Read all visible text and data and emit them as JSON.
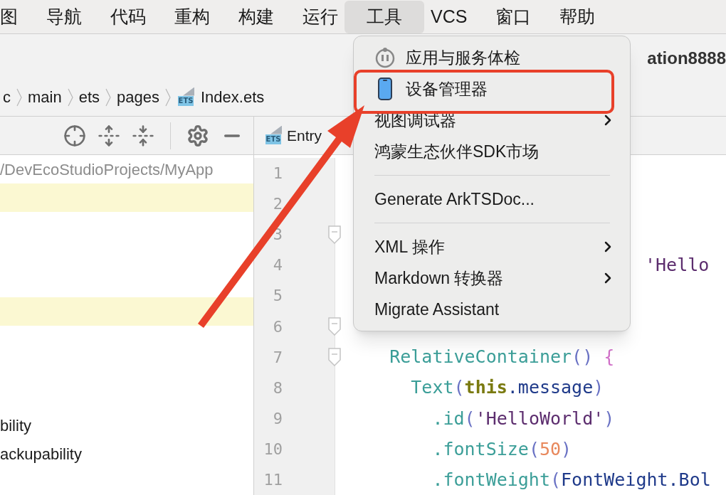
{
  "menubar": [
    {
      "label": "图",
      "selected": false
    },
    {
      "label": "导航",
      "selected": false
    },
    {
      "label": "代码",
      "selected": false
    },
    {
      "label": "重构",
      "selected": false
    },
    {
      "label": "构建",
      "selected": false
    },
    {
      "label": "运行",
      "selected": false
    },
    {
      "label": "工具",
      "selected": true
    },
    {
      "label": "VCS",
      "selected": false
    },
    {
      "label": "窗口",
      "selected": false
    },
    {
      "label": "帮助",
      "selected": false
    }
  ],
  "window_title": "ation8888",
  "breadcrumbs": [
    {
      "label": "c",
      "kind": "folder"
    },
    {
      "label": "main",
      "kind": "folder"
    },
    {
      "label": "ets",
      "kind": "folder"
    },
    {
      "label": "pages",
      "kind": "folder"
    },
    {
      "label": "Index.ets",
      "kind": "file",
      "icon_text": "ETS"
    }
  ],
  "project_panel": {
    "path": "/DevEcoStudioProjects/MyApp",
    "rows": [
      {
        "highlighted": true
      },
      {
        "highlighted": false
      },
      {
        "highlighted": false
      },
      {
        "highlighted": false
      },
      {
        "highlighted": true
      },
      {
        "highlighted": false
      },
      {
        "highlighted": false
      },
      {
        "highlighted": false
      },
      {
        "text": "bility",
        "highlighted": false
      },
      {
        "text": "ackupability",
        "highlighted": false
      }
    ]
  },
  "editor": {
    "tab": {
      "label": "Entry",
      "icon_text": "ETS"
    },
    "lines": [
      {
        "number": "1",
        "fold": false
      },
      {
        "number": "2",
        "fold": false
      },
      {
        "number": "3",
        "fold": true
      },
      {
        "number": "4",
        "fold": false,
        "kind": "covered",
        "tokens": [
          {
            "text": "'Hello",
            "kind": "str"
          }
        ]
      },
      {
        "number": "5",
        "fold": false
      },
      {
        "number": "6",
        "fold": true
      },
      {
        "number": "7",
        "fold": true,
        "kind": "code",
        "tokens": [
          {
            "text": "    RelativeContainer",
            "kind": "fn"
          },
          {
            "text": "()",
            "kind": "paren"
          },
          {
            "text": " {",
            "kind": "brace"
          }
        ]
      },
      {
        "number": "8",
        "fold": false,
        "kind": "code",
        "tokens": [
          {
            "text": "      Text",
            "kind": "fn"
          },
          {
            "text": "(",
            "kind": "paren"
          },
          {
            "text": "this",
            "kind": "kw"
          },
          {
            "text": ".message",
            "kind": "field"
          },
          {
            "text": ")",
            "kind": "paren"
          }
        ]
      },
      {
        "number": "9",
        "fold": false,
        "kind": "code",
        "tokens": [
          {
            "text": "        .id",
            "kind": "fn"
          },
          {
            "text": "(",
            "kind": "paren"
          },
          {
            "text": "'HelloWorld'",
            "kind": "str"
          },
          {
            "text": ")",
            "kind": "paren"
          }
        ]
      },
      {
        "number": "10",
        "fold": false,
        "kind": "code",
        "tokens": [
          {
            "text": "        .fontSize",
            "kind": "fn"
          },
          {
            "text": "(",
            "kind": "paren"
          },
          {
            "text": "50",
            "kind": "num"
          },
          {
            "text": ")",
            "kind": "paren"
          }
        ]
      },
      {
        "number": "11",
        "fold": false,
        "kind": "code",
        "tokens": [
          {
            "text": "        .fontWeight",
            "kind": "fn"
          },
          {
            "text": "(",
            "kind": "paren"
          },
          {
            "text": "FontWeight.Bol",
            "kind": "field"
          }
        ]
      }
    ]
  },
  "tools_menu": [
    {
      "kind": "check",
      "label": "应用与服务体检"
    },
    {
      "kind": "device",
      "label": "设备管理器"
    },
    {
      "kind": "submenu",
      "label": "视图调试器"
    },
    {
      "kind": "item",
      "label": "鸿蒙生态伙伴SDK市场"
    },
    {
      "kind": "separator"
    },
    {
      "kind": "item",
      "label": "Generate ArkTSDoc..."
    },
    {
      "kind": "separator"
    },
    {
      "kind": "submenu",
      "label": "XML 操作"
    },
    {
      "kind": "submenu",
      "label": "Markdown 转换器"
    },
    {
      "kind": "item",
      "label": "Migrate Assistant"
    }
  ]
}
